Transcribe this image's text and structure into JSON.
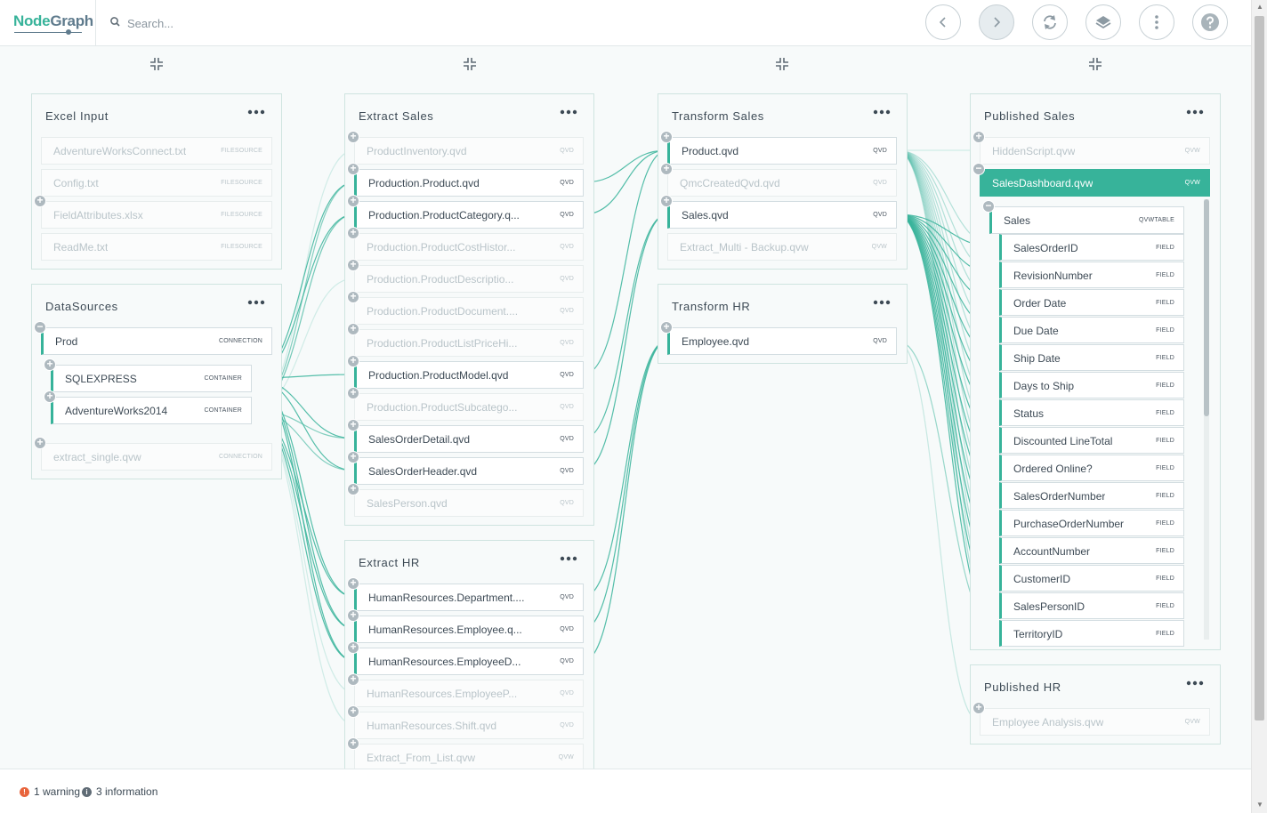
{
  "app": {
    "logo_part1": "Node",
    "logo_part2": "Graph"
  },
  "search": {
    "placeholder": "Search..."
  },
  "toolbar": [
    {
      "name": "back-button",
      "icon": "chevron-left-icon"
    },
    {
      "name": "forward-button",
      "icon": "chevron-right-icon"
    },
    {
      "name": "refresh-button",
      "icon": "refresh-icon"
    },
    {
      "name": "layers-button",
      "icon": "layers-icon"
    },
    {
      "name": "more-menu-button",
      "icon": "vertical-dots-icon"
    },
    {
      "name": "help-button",
      "icon": "help-icon"
    }
  ],
  "groups": {
    "excel_input": {
      "title": "Excel Input",
      "nodes": [
        {
          "label": "AdventureWorksConnect.txt",
          "type": "FILESOURCE",
          "state": "off"
        },
        {
          "label": "Config.txt",
          "type": "FILESOURCE",
          "state": "off"
        },
        {
          "label": "FieldAttributes.xlsx",
          "type": "FILESOURCE",
          "state": "off"
        },
        {
          "label": "ReadMe.txt",
          "type": "FILESOURCE",
          "state": "off"
        }
      ]
    },
    "datasources": {
      "title": "DataSources",
      "nodes": [
        {
          "label": "Prod",
          "type": "CONNECTION",
          "state": "on"
        },
        {
          "label": "SQLEXPRESS",
          "type": "CONTAINER",
          "state": "on"
        },
        {
          "label": "AdventureWorks2014",
          "type": "CONTAINER",
          "state": "on"
        },
        {
          "label": "extract_single.qvw",
          "type": "CONNECTION",
          "state": "off"
        }
      ]
    },
    "extract_sales": {
      "title": "Extract Sales",
      "nodes": [
        {
          "label": "ProductInventory.qvd",
          "type": "QVD",
          "state": "off"
        },
        {
          "label": "Production.Product.qvd",
          "type": "QVD",
          "state": "on"
        },
        {
          "label": "Production.ProductCategory.q...",
          "type": "QVD",
          "state": "on"
        },
        {
          "label": "Production.ProductCostHistor...",
          "type": "QVD",
          "state": "off"
        },
        {
          "label": "Production.ProductDescriptio...",
          "type": "QVD",
          "state": "off"
        },
        {
          "label": "Production.ProductDocument....",
          "type": "QVD",
          "state": "off"
        },
        {
          "label": "Production.ProductListPriceHi...",
          "type": "QVD",
          "state": "off"
        },
        {
          "label": "Production.ProductModel.qvd",
          "type": "QVD",
          "state": "on"
        },
        {
          "label": "Production.ProductSubcatego...",
          "type": "QVD",
          "state": "off"
        },
        {
          "label": "SalesOrderDetail.qvd",
          "type": "QVD",
          "state": "on"
        },
        {
          "label": "SalesOrderHeader.qvd",
          "type": "QVD",
          "state": "on"
        },
        {
          "label": "SalesPerson.qvd",
          "type": "QVD",
          "state": "off"
        }
      ]
    },
    "extract_hr": {
      "title": "Extract HR",
      "nodes": [
        {
          "label": "HumanResources.Department....",
          "type": "QVD",
          "state": "on"
        },
        {
          "label": "HumanResources.Employee.q...",
          "type": "QVD",
          "state": "on"
        },
        {
          "label": "HumanResources.EmployeeD...",
          "type": "QVD",
          "state": "on"
        },
        {
          "label": "HumanResources.EmployeeP...",
          "type": "QVD",
          "state": "off"
        },
        {
          "label": "HumanResources.Shift.qvd",
          "type": "QVD",
          "state": "off"
        },
        {
          "label": "Extract_From_List.qvw",
          "type": "QVW",
          "state": "off"
        }
      ]
    },
    "transform_sales": {
      "title": "Transform Sales",
      "nodes": [
        {
          "label": "Product.qvd",
          "type": "QVD",
          "state": "on"
        },
        {
          "label": "QmcCreatedQvd.qvd",
          "type": "QVD",
          "state": "off"
        },
        {
          "label": "Sales.qvd",
          "type": "QVD",
          "state": "on"
        },
        {
          "label": "Extract_Multi - Backup.qvw",
          "type": "QVW",
          "state": "off"
        }
      ]
    },
    "transform_hr": {
      "title": "Transform HR",
      "nodes": [
        {
          "label": "Employee.qvd",
          "type": "QVD",
          "state": "on"
        }
      ]
    },
    "published_sales": {
      "title": "Published Sales",
      "nodes": [
        {
          "label": "HiddenScript.qvw",
          "type": "QVW",
          "state": "off"
        },
        {
          "label": "SalesDashboard.qvw",
          "type": "QVW",
          "state": "sel"
        },
        {
          "label": "Sales",
          "type": "QVWTABLE",
          "state": "on"
        }
      ],
      "fields": [
        "SalesOrderID",
        "RevisionNumber",
        "Order Date",
        "Due Date",
        "Ship Date",
        "Days to Ship",
        "Status",
        "Discounted LineTotal",
        "Ordered Online?",
        "SalesOrderNumber",
        "PurchaseOrderNumber",
        "AccountNumber",
        "CustomerID",
        "SalesPersonID",
        "TerritoryID"
      ],
      "field_type": "FIELD"
    },
    "published_hr": {
      "title": "Published HR",
      "nodes": [
        {
          "label": "Employee Analysis.qvw",
          "type": "QVW",
          "state": "off"
        }
      ]
    }
  },
  "footer": {
    "warning_text": "1 warning",
    "info_text": "3 information"
  },
  "colors": {
    "accent": "#37b39a",
    "link": "#37b39a",
    "warning": "#e8643c",
    "info": "#5f6b75"
  }
}
